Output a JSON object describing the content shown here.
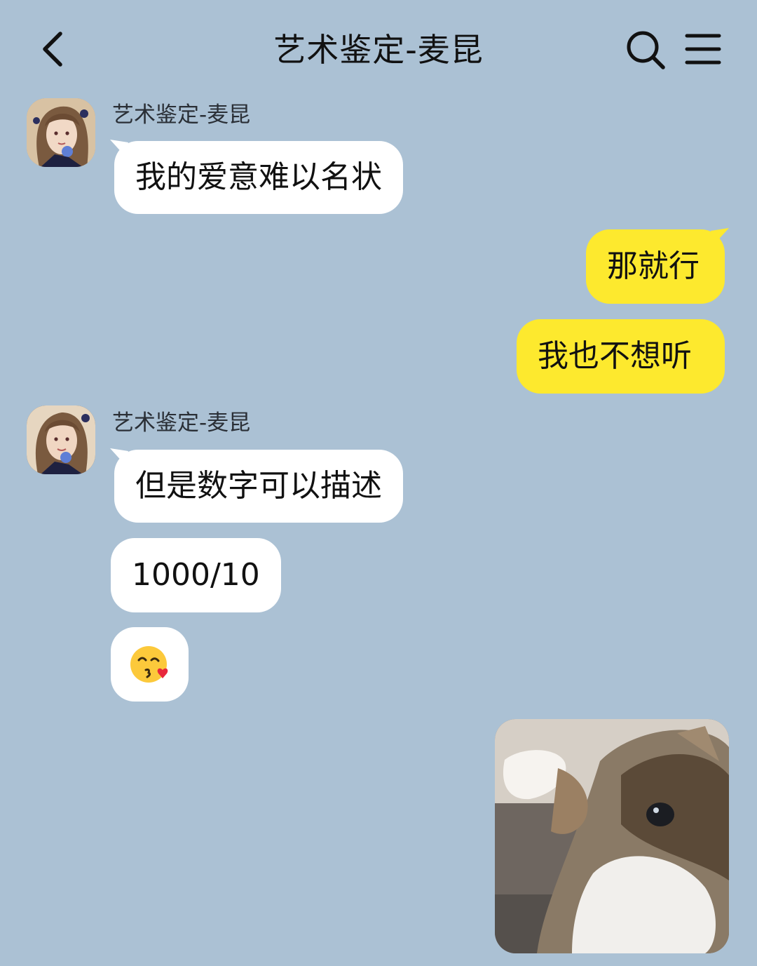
{
  "header": {
    "title": "艺术鉴定-麦昆",
    "back_icon": "chevron-left-icon",
    "search_icon": "search-icon",
    "menu_icon": "menu-icon"
  },
  "colors": {
    "background": "#abc1d4",
    "incoming_bubble": "#ffffff",
    "outgoing_bubble": "#fde92e"
  },
  "messages": [
    {
      "direction": "in",
      "sender": "艺术鉴定-麦昆",
      "text": "我的爱意难以名状"
    },
    {
      "direction": "out",
      "text": "那就行"
    },
    {
      "direction": "out",
      "text": "我也不想听"
    },
    {
      "direction": "in",
      "sender": "艺术鉴定-麦昆",
      "text": "但是数字可以描述"
    },
    {
      "direction": "in",
      "text": "1000/10"
    },
    {
      "direction": "in",
      "text": "😘",
      "kind": "emoji"
    },
    {
      "direction": "out",
      "kind": "image",
      "image_subject": "cat-photo"
    }
  ]
}
